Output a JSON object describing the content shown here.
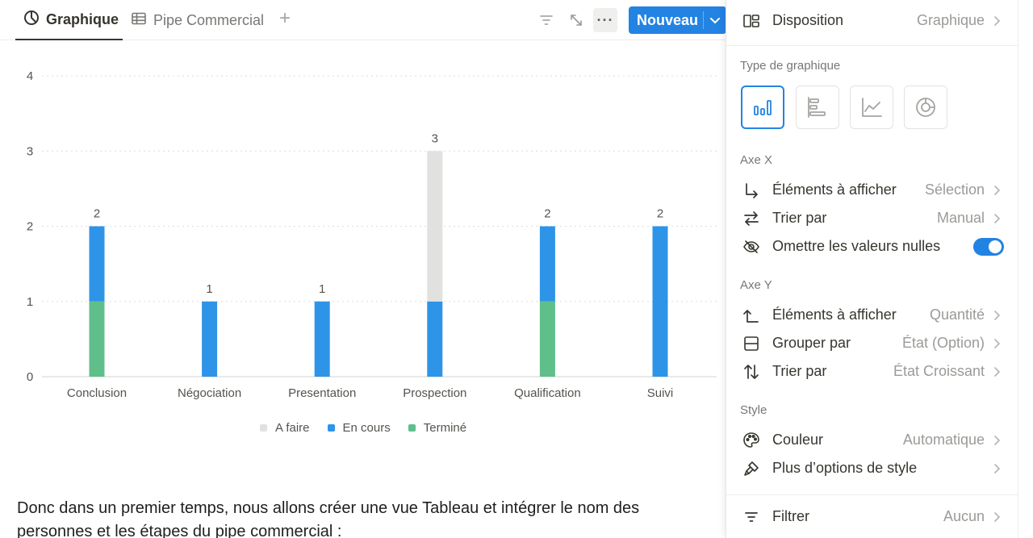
{
  "viewbar": {
    "tabs": [
      {
        "label": "Graphique",
        "icon": "chart-pie-icon"
      },
      {
        "label": "Pipe Commercial",
        "icon": "table-icon"
      }
    ],
    "add_icon": "plus-icon",
    "tools": [
      "filter-icon",
      "expand-icon",
      "more-icon"
    ],
    "new_button": {
      "label": "Nouveau"
    }
  },
  "chart_data": {
    "type": "bar",
    "stacked": true,
    "categories": [
      "Conclusion",
      "Négociation",
      "Presentation",
      "Prospection",
      "Qualification",
      "Suivi"
    ],
    "series": [
      {
        "name": "Terminé",
        "color": "#5fbf8a",
        "values": [
          1,
          0,
          0,
          0,
          1,
          0
        ]
      },
      {
        "name": "En cours",
        "color": "#2e94e8",
        "values": [
          1,
          1,
          1,
          1,
          1,
          2
        ]
      },
      {
        "name": "A faire",
        "color": "#e1e1df",
        "values": [
          0,
          0,
          0,
          2,
          0,
          0
        ]
      }
    ],
    "totals": [
      2,
      1,
      1,
      3,
      2,
      2
    ],
    "ylim": [
      0,
      4
    ],
    "yticks": [
      0,
      1,
      2,
      3,
      4
    ],
    "grid": true,
    "legend_position": "bottom",
    "legend_order": [
      "A faire",
      "En cours",
      "Terminé"
    ]
  },
  "body": {
    "paragraph": "Donc dans un premier temps, nous allons créer une vue Tableau et intégrer le nom des personnes et les étapes du pipe commercial :"
  },
  "panel": {
    "layout": {
      "label": "Disposition",
      "value": "Graphique"
    },
    "chart_type_section": "Type de graphique",
    "chart_types": [
      "vertical-bar-icon",
      "horizontal-bar-icon",
      "line-chart-icon",
      "donut-chart-icon"
    ],
    "selected_chart_type": "vertical-bar-icon",
    "x_axis": {
      "title": "Axe X",
      "show": {
        "label": "Éléments à afficher",
        "value": "Sélection"
      },
      "sort": {
        "label": "Trier par",
        "value": "Manual"
      },
      "omit_nulls": {
        "label": "Omettre les valeurs nulles",
        "on": true
      }
    },
    "y_axis": {
      "title": "Axe Y",
      "show": {
        "label": "Éléments à afficher",
        "value": "Quantité"
      },
      "group": {
        "label": "Grouper par",
        "value": "État (Option)"
      },
      "sort": {
        "label": "Trier par",
        "value": "État Croissant"
      }
    },
    "style": {
      "title": "Style",
      "color": {
        "label": "Couleur",
        "value": "Automatique"
      },
      "more": {
        "label": "Plus d’options de style"
      }
    },
    "filter": {
      "label": "Filtrer",
      "value": "Aucun"
    }
  }
}
